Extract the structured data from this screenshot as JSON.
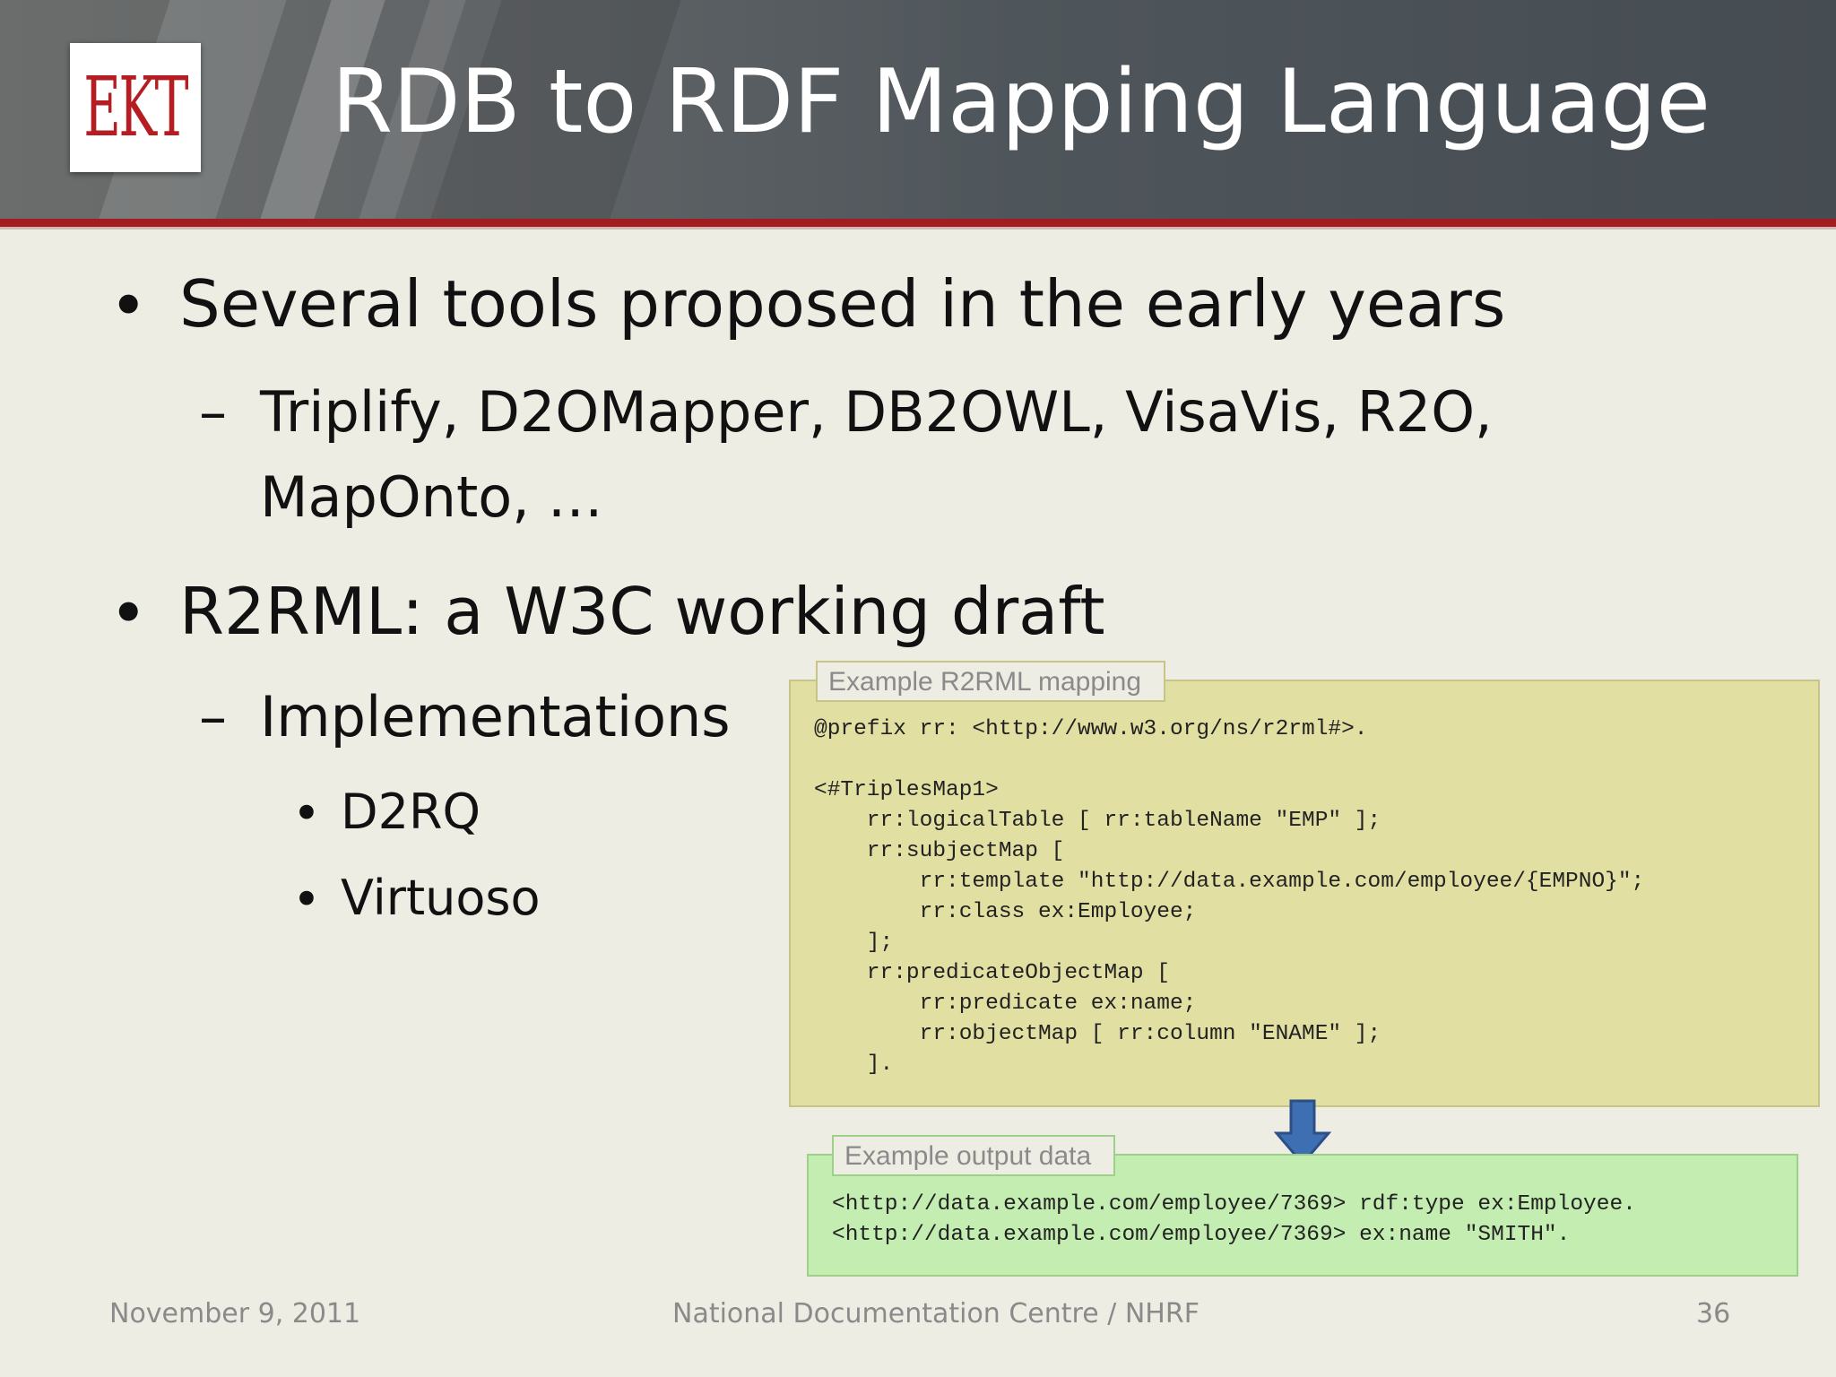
{
  "slide": {
    "logo": {
      "text": "EKT"
    },
    "title": "RDB to RDF Mapping Language",
    "bullets": [
      {
        "text": "Several tools proposed in the early years",
        "sub": [
          {
            "line1": "Triplify, D2OMapper, DB2OWL, VisaVis, R2O,",
            "line2": "MapOnto, …"
          }
        ]
      },
      {
        "text": "R2RML: a W3C working draft",
        "sub": [
          {
            "text": "Implementations",
            "items": [
              "D2RQ",
              "Virtuoso"
            ]
          }
        ]
      }
    ],
    "markers": {
      "bullet": "•",
      "dash": "–"
    },
    "mapping_example": {
      "label": "Example R2RML mapping",
      "code": "@prefix rr: <http://www.w3.org/ns/r2rml#>.\n\n<#TriplesMap1>\n    rr:logicalTable [ rr:tableName \"EMP\" ];\n    rr:subjectMap [\n        rr:template \"http://data.example.com/employee/{EMPNO}\";\n        rr:class ex:Employee;\n    ];\n    rr:predicateObjectMap [\n        rr:predicate ex:name;\n        rr:objectMap [ rr:column \"ENAME\" ];\n    ]."
    },
    "output_example": {
      "label": "Example output data",
      "code": "<http://data.example.com/employee/7369> rdf:type ex:Employee.\n<http://data.example.com/employee/7369> ex:name \"SMITH\"."
    },
    "arrow_icon": "down-arrow",
    "footer": {
      "date": "November 9, 2011",
      "org": "National Documentation Centre / NHRF",
      "page": "36"
    },
    "colors": {
      "header_bg": "#4f565b",
      "accent_red": "#a31c1f",
      "slide_bg": "#eeede4",
      "mapping_panel_bg": "#e2dfa2",
      "output_panel_bg": "#c3edb1",
      "arrow": "#3e6fb3"
    }
  }
}
